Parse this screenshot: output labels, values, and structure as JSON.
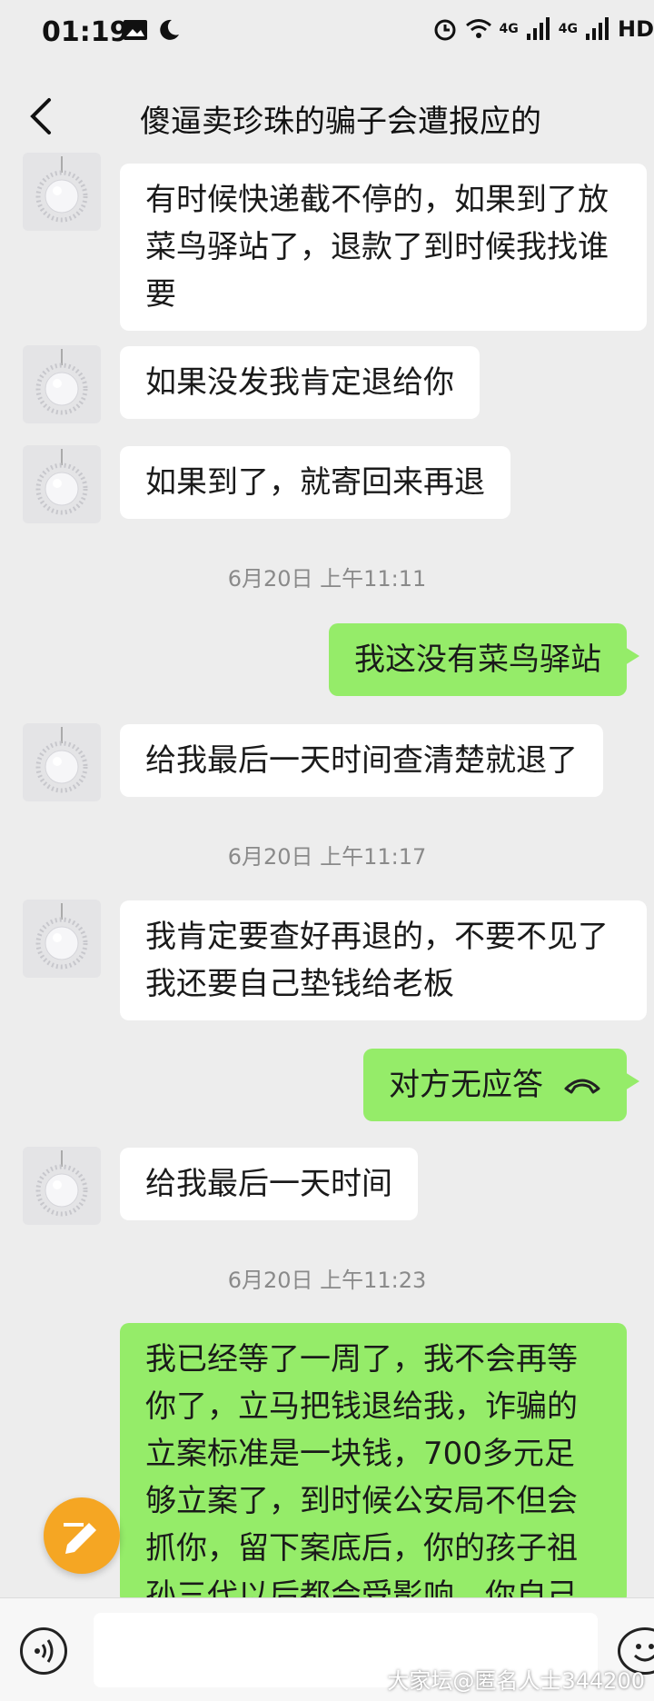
{
  "status_bar": {
    "time": "01:19",
    "network": "4G",
    "network2": "4G",
    "hd": "HD"
  },
  "header": {
    "title": "傻逼卖珍珠的骗子会遭报应的"
  },
  "messages": [
    {
      "type": "in",
      "text": "有时候快递截不停的，如果到了放菜鸟驿站了，退款了到时候我找谁要"
    },
    {
      "type": "in",
      "text": "如果没发我肯定退给你"
    },
    {
      "type": "in",
      "text": "如果到了，就寄回来再退"
    },
    {
      "type": "time",
      "text": "6月20日 上午11:11"
    },
    {
      "type": "out",
      "text": "我这没有菜鸟驿站"
    },
    {
      "type": "in",
      "text": "给我最后一天时间查清楚就退了"
    },
    {
      "type": "time",
      "text": "6月20日 上午11:17"
    },
    {
      "type": "in",
      "text": "我肯定要查好再退的，不要不见了我还要自己垫钱给老板"
    },
    {
      "type": "out_call",
      "text": "对方无应答"
    },
    {
      "type": "in",
      "text": "给我最后一天时间"
    },
    {
      "type": "time",
      "text": "6月20日 上午11:23"
    },
    {
      "type": "out",
      "text": "我已经等了一周了，我不会再等你了，立马把钱退给我，诈骗的立案标准是一块钱，700多元足够立案了，到时候公安局不但会抓你，留下案底后，你的孩子祖孙三代以后都会受影响，你自己考虑清楚！"
    }
  ],
  "watermark": "大家坛@匿名人士344200"
}
